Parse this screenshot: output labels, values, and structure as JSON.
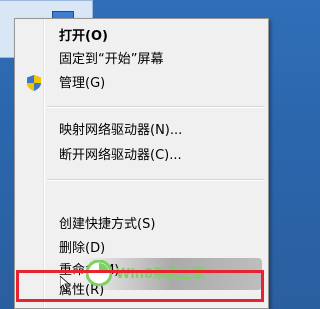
{
  "menu": {
    "items": [
      {
        "label": "打开(O)"
      },
      {
        "label": "固定到“开始”屏幕"
      },
      {
        "label": "管理(G)"
      },
      {
        "label": "映射网络驱动器(N)..."
      },
      {
        "label": "断开网络驱动器(C)..."
      },
      {
        "label": "创建快捷方式(S)"
      },
      {
        "label": "删除(D)"
      },
      {
        "label": "重命名(M)"
      },
      {
        "label": "属性(R)"
      }
    ],
    "icons": {
      "manage": "uac-shield-icon"
    }
  },
  "watermark": {
    "text": "Win8系统之家"
  },
  "colors": {
    "desktop": "#2f6fb8",
    "menu_bg": "#f0f0f0",
    "highlight_border": "#e6232e",
    "watermark_green": "#7bd25f"
  }
}
